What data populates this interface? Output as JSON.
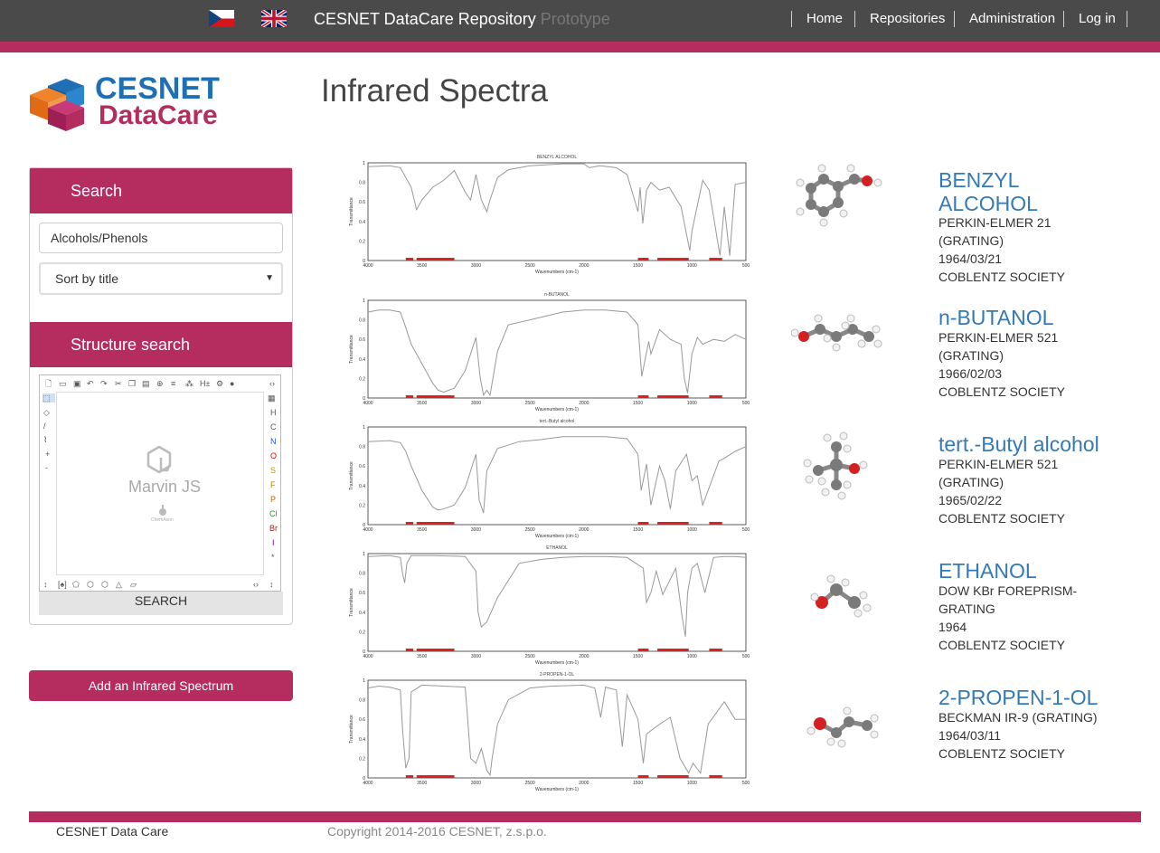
{
  "header": {
    "brand": "CESNET DataCare Repository",
    "brand_suffix": "Prototype",
    "nav": [
      "Home",
      "Repositories",
      "Administration",
      "Log in"
    ]
  },
  "logo": {
    "line1": "CESNET",
    "line2": "DataCare"
  },
  "page_title": "Infrared Spectra",
  "sidebar": {
    "search_title": "Search",
    "search_value": "Alcohols/Phenols",
    "sort_value": "Sort by title",
    "structure_title": "Structure search",
    "marvin_label": "Marvin JS",
    "marvin_sub": "ChemAxon",
    "search_button": "SEARCH",
    "element_tools": [
      "H",
      "C",
      "N",
      "O",
      "S",
      "F",
      "P",
      "Cl",
      "Br",
      "I",
      "*"
    ],
    "add_button": "Add an Infrared Spectrum"
  },
  "results": [
    {
      "chart_title": "BENZYL ALCOHOL",
      "title_lines": [
        "BENZYL",
        "ALCOHOL"
      ],
      "meta": [
        "PERKIN-ELMER 21",
        "(GRATING)",
        "1964/03/21",
        "COBLENTZ SOCIETY"
      ]
    },
    {
      "chart_title": "n-BUTANOL",
      "title_lines": [
        "n-BUTANOL"
      ],
      "meta": [
        "PERKIN-ELMER 521",
        "(GRATING)",
        "1966/02/03",
        "COBLENTZ SOCIETY"
      ]
    },
    {
      "chart_title": "tert.-Butyl alcohol",
      "title_lines": [
        "tert.-Butyl alcohol"
      ],
      "meta": [
        "PERKIN-ELMER 521",
        "(GRATING)",
        "1965/02/22",
        "COBLENTZ SOCIETY"
      ]
    },
    {
      "chart_title": "ETHANOL",
      "title_lines": [
        "ETHANOL"
      ],
      "meta": [
        "DOW KBr FOREPRISM-",
        "GRATING",
        "1964",
        "COBLENTZ SOCIETY"
      ]
    },
    {
      "chart_title": "2-PROPEN-1-OL",
      "title_lines": [
        "2-PROPEN-1-OL"
      ],
      "meta": [
        "BECKMAN IR-9 (GRATING)",
        "1964/03/11",
        "COBLENTZ SOCIETY"
      ]
    }
  ],
  "chart_data": [
    {
      "type": "line",
      "title": "BENZYL ALCOHOL",
      "xlabel": "Wavenumbers (cm-1)",
      "ylabel": "Transmittance",
      "xlim": [
        4000,
        500
      ],
      "ylim": [
        0,
        1
      ],
      "x_ticks": [
        4000,
        3500,
        3000,
        2500,
        2000,
        1500,
        1000,
        500
      ],
      "y_ticks": [
        0,
        0.2,
        0.4,
        0.6,
        0.8,
        1
      ],
      "x": [
        4000,
        3800,
        3700,
        3650,
        3600,
        3550,
        3500,
        3400,
        3300,
        3200,
        3100,
        3050,
        3000,
        2950,
        2900,
        2870,
        2800,
        2700,
        2500,
        2200,
        2000,
        1950,
        1850,
        1700,
        1600,
        1500,
        1480,
        1455,
        1420,
        1380,
        1300,
        1210,
        1100,
        1020,
        1000,
        900,
        840,
        740,
        700,
        650,
        600,
        500
      ],
      "y": [
        0.96,
        0.97,
        0.95,
        0.85,
        0.75,
        0.52,
        0.62,
        0.75,
        0.82,
        0.92,
        0.7,
        0.62,
        0.88,
        0.62,
        0.5,
        0.62,
        0.85,
        0.93,
        0.97,
        0.99,
        0.99,
        0.95,
        0.97,
        0.95,
        0.88,
        0.5,
        0.75,
        0.38,
        0.72,
        0.8,
        0.72,
        0.75,
        0.55,
        0.1,
        0.3,
        0.82,
        0.72,
        0.05,
        0.55,
        0.05,
        0.78,
        0.8
      ]
    },
    {
      "type": "line",
      "title": "n-BUTANOL",
      "xlabel": "Wavenumbers (cm-1)",
      "ylabel": "Transmittance",
      "xlim": [
        4000,
        500
      ],
      "ylim": [
        0,
        1
      ],
      "x_ticks": [
        4000,
        3500,
        3000,
        2500,
        2000,
        1500,
        1000,
        500
      ],
      "y_ticks": [
        0,
        0.2,
        0.4,
        0.6,
        0.8,
        1
      ],
      "x": [
        4000,
        3900,
        3800,
        3700,
        3650,
        3600,
        3500,
        3400,
        3350,
        3300,
        3200,
        3100,
        3000,
        2960,
        2930,
        2900,
        2870,
        2800,
        2700,
        2500,
        2200,
        2000,
        1800,
        1600,
        1500,
        1465,
        1400,
        1380,
        1300,
        1200,
        1100,
        1070,
        1040,
        1000,
        950,
        900,
        800,
        700,
        600,
        500
      ],
      "y": [
        0.88,
        0.9,
        0.9,
        0.88,
        0.72,
        0.55,
        0.35,
        0.15,
        0.08,
        0.06,
        0.1,
        0.28,
        0.62,
        0.2,
        0.03,
        0.08,
        0.03,
        0.48,
        0.75,
        0.8,
        0.88,
        0.9,
        0.9,
        0.88,
        0.75,
        0.22,
        0.58,
        0.45,
        0.7,
        0.6,
        0.55,
        0.2,
        0.05,
        0.45,
        0.62,
        0.55,
        0.6,
        0.58,
        0.65,
        0.6
      ]
    },
    {
      "type": "line",
      "title": "tert.-Butyl alcohol",
      "xlabel": "Wavenumbers (cm-1)",
      "ylabel": "Transmittance",
      "xlim": [
        4000,
        500
      ],
      "ylim": [
        0,
        1
      ],
      "x_ticks": [
        4000,
        3500,
        3000,
        2500,
        2000,
        1500,
        1000,
        500
      ],
      "y_ticks": [
        0,
        0.2,
        0.4,
        0.6,
        0.8,
        1
      ],
      "x": [
        4000,
        3800,
        3700,
        3650,
        3600,
        3500,
        3400,
        3350,
        3300,
        3200,
        3100,
        3050,
        3000,
        2970,
        2930,
        2900,
        2800,
        2600,
        2400,
        2200,
        2000,
        1800,
        1600,
        1500,
        1470,
        1420,
        1380,
        1360,
        1300,
        1250,
        1200,
        1150,
        1050,
        1000,
        950,
        900,
        750,
        700,
        600,
        500
      ],
      "y": [
        0.85,
        0.86,
        0.84,
        0.75,
        0.6,
        0.35,
        0.18,
        0.15,
        0.16,
        0.2,
        0.38,
        0.55,
        0.72,
        0.25,
        0.12,
        0.55,
        0.78,
        0.85,
        0.87,
        0.9,
        0.9,
        0.9,
        0.88,
        0.72,
        0.35,
        0.62,
        0.2,
        0.3,
        0.6,
        0.45,
        0.16,
        0.55,
        0.72,
        0.45,
        0.5,
        0.2,
        0.65,
        0.68,
        0.75,
        0.8
      ]
    },
    {
      "type": "line",
      "title": "ETHANOL",
      "xlabel": "Wavenumbers (cm-1)",
      "ylabel": "Transmittance",
      "xlim": [
        4000,
        500
      ],
      "ylim": [
        0,
        1
      ],
      "x_ticks": [
        4000,
        3500,
        3000,
        2500,
        2000,
        1500,
        1000,
        500
      ],
      "y_ticks": [
        0,
        0.2,
        0.4,
        0.6,
        0.8,
        1
      ],
      "x": [
        4000,
        3800,
        3700,
        3680,
        3660,
        3640,
        3600,
        3400,
        3100,
        3000,
        2980,
        2950,
        2900,
        2800,
        2600,
        2400,
        2200,
        2000,
        1800,
        1600,
        1450,
        1420,
        1380,
        1330,
        1270,
        1150,
        1090,
        1060,
        1040,
        1000,
        950,
        880,
        800,
        700,
        600,
        500
      ],
      "y": [
        0.97,
        0.98,
        0.96,
        0.8,
        0.7,
        0.9,
        0.98,
        0.98,
        0.97,
        0.82,
        0.4,
        0.25,
        0.3,
        0.55,
        0.9,
        0.94,
        0.96,
        0.97,
        0.97,
        0.96,
        0.85,
        0.5,
        0.6,
        0.82,
        0.58,
        0.85,
        0.35,
        0.15,
        0.6,
        0.85,
        0.9,
        0.6,
        0.96,
        0.97,
        0.97,
        0.96
      ]
    },
    {
      "type": "line",
      "title": "2-PROPEN-1-OL",
      "xlabel": "Wavenumbers (cm-1)",
      "ylabel": "Transmittance",
      "xlim": [
        4000,
        500
      ],
      "ylim": [
        0,
        1
      ],
      "x_ticks": [
        4000,
        3500,
        3000,
        2500,
        2000,
        1500,
        1000,
        500
      ],
      "y_ticks": [
        0,
        0.2,
        0.4,
        0.6,
        0.8,
        1
      ],
      "x": [
        4000,
        3900,
        3800,
        3700,
        3680,
        3650,
        3620,
        3600,
        3500,
        3300,
        3100,
        3080,
        3050,
        3000,
        2950,
        2900,
        2870,
        2850,
        2800,
        2700,
        2500,
        2300,
        2000,
        1900,
        1845,
        1800,
        1700,
        1645,
        1600,
        1500,
        1450,
        1420,
        1300,
        1200,
        1110,
        1030,
        990,
        920,
        850,
        700,
        600,
        500
      ],
      "y": [
        0.92,
        0.94,
        0.93,
        0.9,
        0.5,
        0.1,
        0.2,
        0.88,
        0.95,
        0.94,
        0.93,
        0.65,
        0.2,
        0.15,
        0.3,
        0.08,
        0.03,
        0.2,
        0.55,
        0.8,
        0.92,
        0.94,
        0.95,
        0.92,
        0.62,
        0.93,
        0.9,
        0.32,
        0.85,
        0.6,
        0.15,
        0.45,
        0.55,
        0.62,
        0.2,
        0.05,
        0.15,
        0.05,
        0.55,
        0.78,
        0.6,
        0.6
      ]
    }
  ]
}
